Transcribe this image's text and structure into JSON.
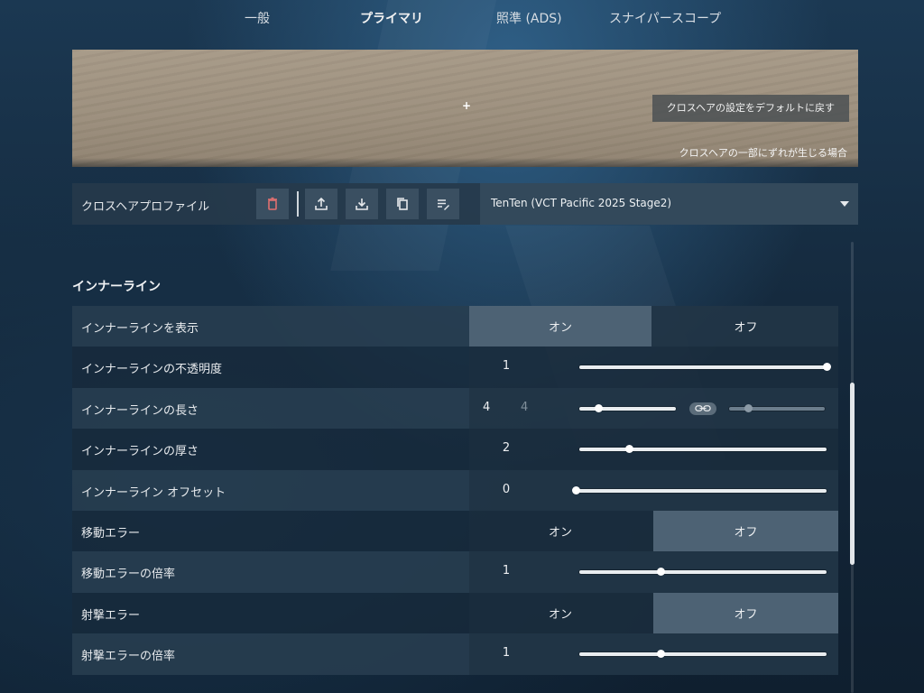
{
  "tabs": [
    {
      "label": "一般"
    },
    {
      "label": "プライマリ"
    },
    {
      "label": "照準 (ADS)"
    },
    {
      "label": "スナイパースコープ"
    }
  ],
  "preview": {
    "crosshair": "+",
    "reset_label": "クロスヘアの設定をデフォルトに戻す",
    "misalign_label": "クロスヘアの一部にずれが生じる場合"
  },
  "profile": {
    "label": "クロスヘアプロファイル",
    "selected": "TenTen (VCT Pacific 2025 Stage2)",
    "buttons": [
      "trash-icon",
      "upload-icon",
      "download-icon",
      "copy-icon",
      "rename-icon"
    ],
    "colors": {
      "trash": "#e07070"
    }
  },
  "section": {
    "title": "インナーライン"
  },
  "toggle_labels": {
    "on": "オン",
    "off": "オフ"
  },
  "rows": [
    {
      "label": "インナーラインを表示",
      "type": "toggle",
      "selected": "on"
    },
    {
      "label": "インナーラインの不透明度",
      "type": "slider",
      "value": "1",
      "fraction": 1.0
    },
    {
      "label": "インナーラインの長さ",
      "type": "dual_slider",
      "value": "4",
      "value2": "4",
      "fraction": 0.2,
      "fraction2": 0.2
    },
    {
      "label": "インナーラインの厚さ",
      "type": "slider",
      "value": "2",
      "fraction": 0.2
    },
    {
      "label": "インナーライン オフセット",
      "type": "slider",
      "value": "0",
      "fraction": 0.0
    },
    {
      "label": "移動エラー",
      "type": "toggle",
      "selected": "off"
    },
    {
      "label": "移動エラーの倍率",
      "type": "slider",
      "value": "1",
      "fraction": 0.33
    },
    {
      "label": "射撃エラー",
      "type": "toggle",
      "selected": "off"
    },
    {
      "label": "射撃エラーの倍率",
      "type": "slider",
      "value": "1",
      "fraction": 0.33
    }
  ]
}
